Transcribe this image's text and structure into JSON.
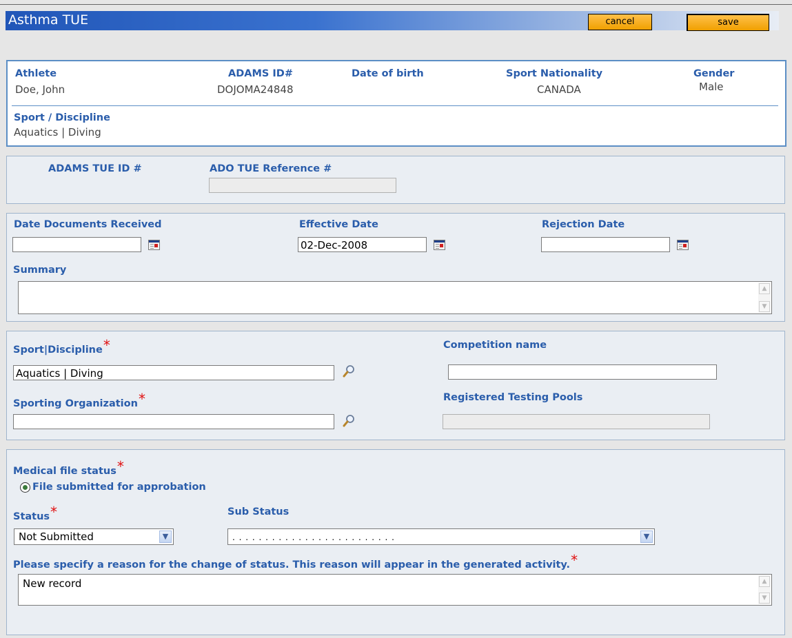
{
  "window": {
    "title": "Asthma TUE"
  },
  "toolbar": {
    "cancel_label": "cancel",
    "save_label": "save"
  },
  "athlete_info": {
    "athlete_label": "Athlete",
    "athlete_value": "Doe, John",
    "adams_id_label": "ADAMS ID#",
    "adams_id_value": "DOJOMA24848",
    "dob_label": "Date of birth",
    "dob_value": "",
    "sport_nationality_label": "Sport Nationality",
    "sport_nationality_value": "CANADA",
    "gender_label": "Gender",
    "gender_value": "Male",
    "sport_discipline_label": "Sport / Discipline",
    "sport_discipline_value": "Aquatics | Diving"
  },
  "tue_ids": {
    "adams_tue_id_label": "ADAMS TUE ID #",
    "ado_tue_ref_label": "ADO TUE Reference #",
    "ado_tue_ref_value": ""
  },
  "dates": {
    "date_docs_received_label": "Date Documents Received",
    "date_docs_received_value": "",
    "effective_date_label": "Effective Date",
    "effective_date_value": "02-Dec-2008",
    "rejection_date_label": "Rejection Date",
    "rejection_date_value": "",
    "summary_label": "Summary",
    "summary_value": ""
  },
  "competition": {
    "sport_discipline_label": "Sport|Discipline",
    "sport_discipline_value": "Aquatics | Diving",
    "competition_name_label": "Competition name",
    "competition_name_value": "",
    "sporting_org_label": "Sporting Organization",
    "sporting_org_value": "",
    "rtp_label": "Registered Testing Pools",
    "rtp_value": ""
  },
  "medical": {
    "medical_file_status_label": "Medical file status",
    "radio_label": "File submitted for approbation",
    "status_label": "Status",
    "status_value": "Not Submitted",
    "sub_status_label": "Sub Status",
    "sub_status_value": ". . . . . . . . . . . . . . . . . . . . . . . . .",
    "reason_label": "Please specify a reason for the change of status. This reason will appear in the generated activity.",
    "reason_value": "New record"
  },
  "colors": {
    "label_blue": "#2a5dab",
    "required_red": "#e01010",
    "button_orange": "#f5a800",
    "title_blue": "#2156b8"
  },
  "icons": [
    "calendar-icon",
    "magnifier-icon",
    "chevron-down-icon",
    "scroll-up-arrow",
    "scroll-down-arrow"
  ]
}
